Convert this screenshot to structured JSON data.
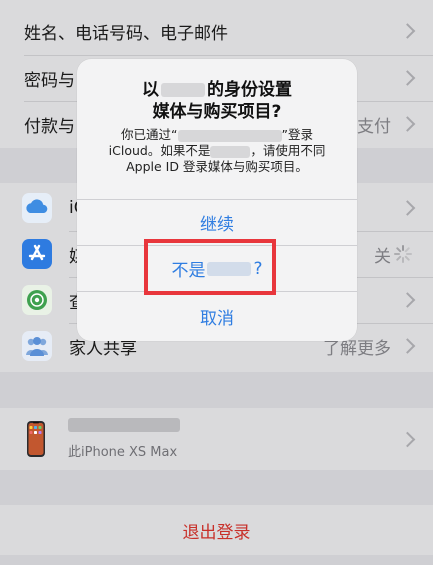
{
  "settings": {
    "rows": [
      {
        "label": "姓名、电话号码、电子邮件"
      },
      {
        "label": "密码与"
      },
      {
        "label": "付款与",
        "detail": "支付"
      }
    ],
    "apps": [
      {
        "label": "iC"
      },
      {
        "label": "媒",
        "detail": "关"
      },
      {
        "label": "查"
      },
      {
        "label": "家人共享",
        "detail": "了解更多"
      }
    ],
    "device": {
      "subtitle": "此iPhone XS Max"
    },
    "sign_out": "退出登录"
  },
  "alert": {
    "title_line1_prefix": "以",
    "title_line1_suffix": "的身份设置",
    "title_line2": "媒体与购买项目?",
    "message_part1": "你已通过“",
    "message_part2": "”登录",
    "message_part3": "iCloud。如果不是",
    "message_part4": "，请使用不同",
    "message_part5": "Apple ID 登录媒体与购买项目。",
    "continue_label": "继续",
    "not_me_prefix": "不是",
    "not_me_suffix": "?",
    "cancel_label": "取消"
  },
  "colors": {
    "accent": "#2F7DE1",
    "destructive": "#C8302A",
    "highlight": "#E8363C"
  },
  "icons": {
    "icloud": "cloud-icon",
    "app_store": "app-store-icon",
    "find_my": "find-my-icon",
    "family": "family-sharing-icon",
    "device": "iphone-icon"
  }
}
